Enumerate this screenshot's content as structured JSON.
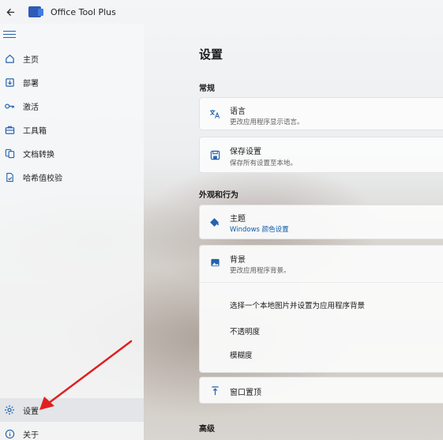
{
  "app": {
    "title": "Office Tool Plus"
  },
  "sidebar": {
    "items": [
      {
        "label": "主页",
        "icon": "home-icon"
      },
      {
        "label": "部署",
        "icon": "deploy-icon"
      },
      {
        "label": "激活",
        "icon": "key-icon"
      },
      {
        "label": "工具箱",
        "icon": "toolbox-icon"
      },
      {
        "label": "文档转换",
        "icon": "document-convert-icon"
      },
      {
        "label": "哈希值校验",
        "icon": "hash-check-icon"
      }
    ],
    "bottom": [
      {
        "label": "设置",
        "icon": "gear-icon"
      },
      {
        "label": "关于",
        "icon": "info-icon"
      }
    ]
  },
  "main": {
    "title": "设置",
    "sections": {
      "general": "常规",
      "appearance": "外观和行为",
      "advanced": "高级"
    },
    "cards": {
      "language": {
        "title": "语言",
        "desc": "更改应用程序显示语言。"
      },
      "save": {
        "title": "保存设置",
        "desc": "保存所有设置至本地。"
      },
      "theme": {
        "title": "主题",
        "desc": "Windows 颜色设置"
      },
      "background": {
        "title": "背景",
        "desc": "更改应用程序背景。",
        "options": [
          "选择一个本地图片并设置为应用程序背景",
          "不透明度",
          "模糊度"
        ]
      },
      "topmost": {
        "title": "窗口置顶"
      }
    }
  },
  "colors": {
    "accent": "#2563ad",
    "annotation_arrow": "#e02020"
  }
}
